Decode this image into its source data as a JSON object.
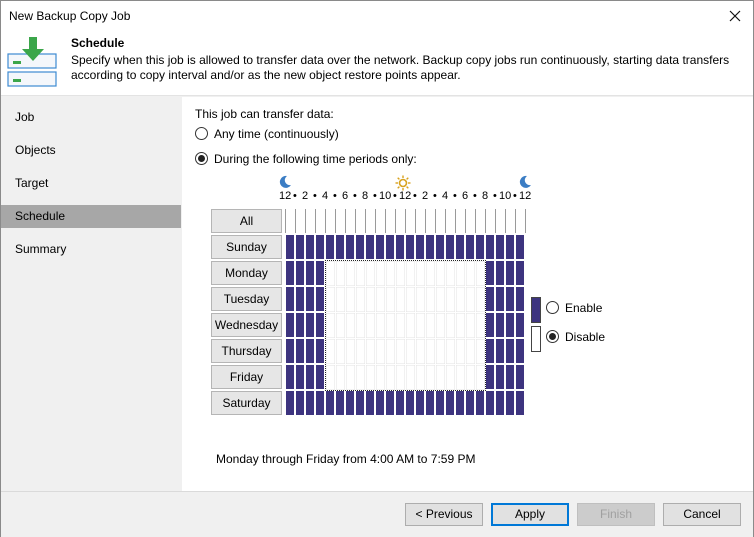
{
  "window": {
    "title": "New Backup Copy Job"
  },
  "header": {
    "title": "Schedule",
    "description": "Specify when this job is allowed to transfer data over the network. Backup copy jobs run continuously, starting data transfers according to copy interval and/or as the new object restore points appear."
  },
  "sidebar": {
    "items": [
      {
        "label": "Job"
      },
      {
        "label": "Objects"
      },
      {
        "label": "Target"
      },
      {
        "label": "Schedule",
        "active": true
      },
      {
        "label": "Summary"
      }
    ]
  },
  "schedule": {
    "intro": "This job can transfer data:",
    "option_any": "Any time (continuously)",
    "option_periods": "During the following time periods only:",
    "selected_option": "periods",
    "hour_labels": [
      "12",
      "2",
      "4",
      "6",
      "8",
      "10",
      "12",
      "2",
      "4",
      "6",
      "8",
      "10",
      "12"
    ],
    "all_label": "All",
    "days": [
      "Sunday",
      "Monday",
      "Tuesday",
      "Wednesday",
      "Thursday",
      "Friday",
      "Saturday"
    ],
    "enabled_color": "#3d347f",
    "disabled_color": "#ffffff",
    "enabled_windows": {
      "Monday": [
        4,
        19
      ],
      "Tuesday": [
        4,
        19
      ],
      "Wednesday": [
        4,
        19
      ],
      "Thursday": [
        4,
        19
      ],
      "Friday": [
        4,
        19
      ]
    },
    "legend_enable": "Enable",
    "legend_disable": "Disable",
    "legend_selected": "disable",
    "summary": "Monday through Friday from 4:00 AM to 7:59 PM"
  },
  "footer": {
    "previous": "< Previous",
    "apply": "Apply",
    "finish": "Finish",
    "cancel": "Cancel"
  }
}
